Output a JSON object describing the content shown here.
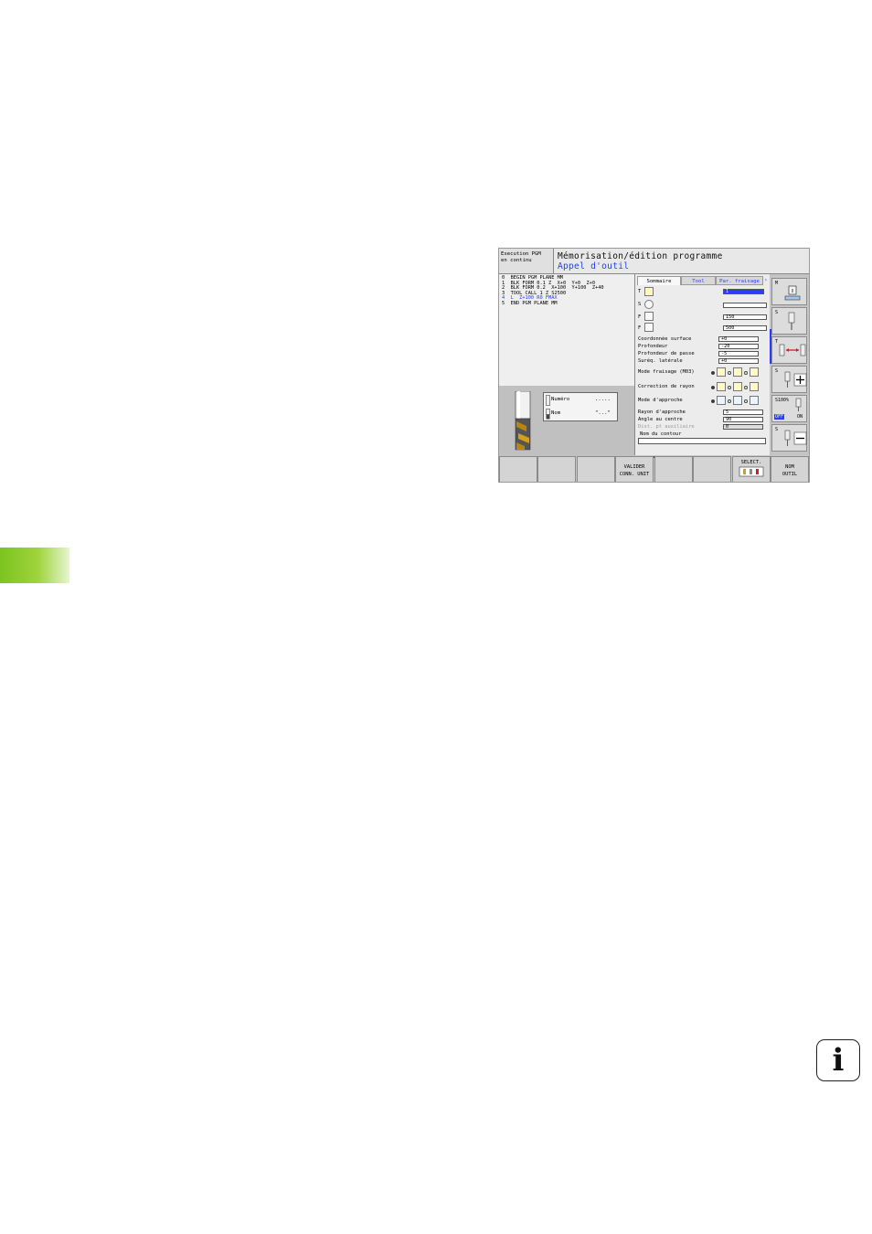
{
  "page": {
    "info_icon": "info-icon",
    "side_tab_color": "#8cc63f"
  },
  "header": {
    "mode_line1": "Execution PGM",
    "mode_line2": "en continu",
    "title": "Mémorisation/édition programme",
    "subtitle": "Appel d'outil"
  },
  "program": {
    "lines": [
      "0  BEGIN PGM PLANE MM",
      "1  BLK FORM 0.1 Z  X+0  Y+0  Z+0",
      "2  BLK FORM 0.2  X+100  Y+100  Z+40",
      "3  TOOL CALL 1 Z S2500",
      "4  L  Z+100 R0 FMAX",
      "5  END PGM PLANE MM"
    ]
  },
  "preview": {
    "numero_label": "Numéro",
    "numero_value": ".....",
    "nom_label": "Nom",
    "nom_value": "\"...\""
  },
  "form": {
    "tabs": [
      "Sommaire",
      "Tool",
      "Par. fraisage"
    ],
    "tool": {
      "label": "T",
      "value": "1"
    },
    "spindle": {
      "label": "S",
      "value": ""
    },
    "feed1": {
      "label": "F",
      "value": "150"
    },
    "feed2": {
      "label": "F",
      "value": "500"
    },
    "fields": [
      {
        "label": "Coordonnée surface",
        "value": "+0"
      },
      {
        "label": "Profondeur",
        "value": "-20"
      },
      {
        "label": "Profondeur de passe",
        "value": "-5"
      },
      {
        "label": "Suréq. latérale",
        "value": "+0"
      }
    ],
    "mode_fraisage": "Mode fraisage (M03)",
    "correction_rayon": "Correction de rayon",
    "mode_approche": "Mode d'approche",
    "fields2": [
      {
        "label": "Rayon d'approche",
        "value": "5"
      },
      {
        "label": "Angle au centre",
        "value": "90"
      },
      {
        "label": "Dist. pt auxiliaire",
        "value": "0"
      }
    ],
    "contour_label": "Nom du contour",
    "contour_value": ""
  },
  "right_keys": {
    "m": "M",
    "s": "S",
    "t": "T",
    "s_plus": "S",
    "override": "S100%",
    "off": "OFF",
    "on": "ON",
    "s_minus": "S"
  },
  "softkeys": {
    "valider_line1": "VALIDER",
    "valider_line2": "CONN. UNIT",
    "select": "SELECT.",
    "nom_line1": "NOM",
    "nom_line2": "OUTIL"
  }
}
